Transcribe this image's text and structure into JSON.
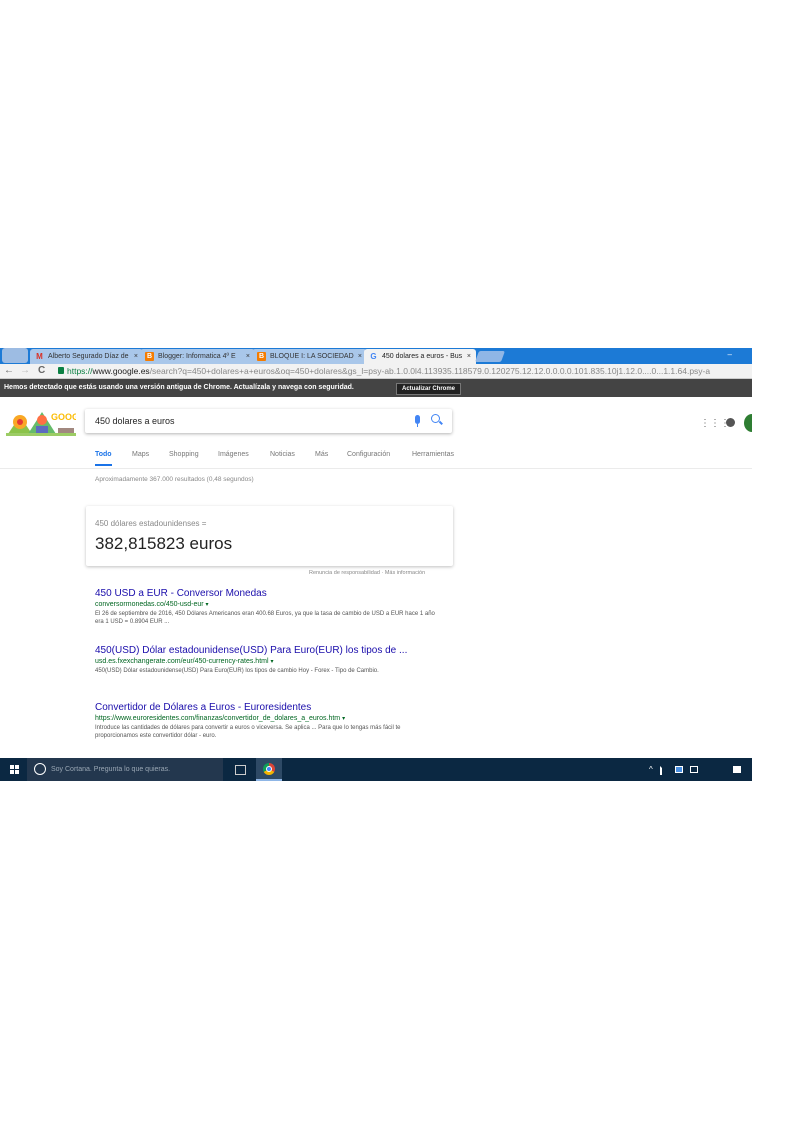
{
  "browser": {
    "tabs": [
      {
        "label": "Alberto Segurado Díaz de",
        "favicon": "gmail-icon",
        "close": "×",
        "active": false
      },
      {
        "label": "Blogger: Informatica 4º E",
        "favicon": "blogger-icon",
        "close": "×",
        "active": false
      },
      {
        "label": "BLOQUE I: LA SOCIEDAD",
        "favicon": "blogger-icon",
        "close": "×",
        "active": false
      },
      {
        "label": "450 dolares a euros - Bus",
        "favicon": "google-icon",
        "close": "×",
        "active": true
      }
    ],
    "minimize": "–",
    "nav": {
      "back": "←",
      "forward": "→",
      "reload": "C"
    },
    "url_scheme": "https://",
    "url_host": "www.google.es",
    "url_rest": "/search?q=450+dolares+a+euros&oq=450+dolares&gs_l=psy-ab.1.0.0l4.113935.118579.0.120275.12.12.0.0.0.0.101.835.10j1.12.0....0...1.1.64.psy-a",
    "infobar_message": "Hemos detectado que estás usando una versión antigua de Chrome. Actualízala y navega con seguridad.",
    "infobar_button": "Actualizar Chrome"
  },
  "google": {
    "logo_text": "GOOGLE",
    "query": "450 dolares a euros",
    "tabs": [
      "Todo",
      "Maps",
      "Shopping",
      "Imágenes",
      "Noticias",
      "Más",
      "Configuración",
      "Herramientas"
    ],
    "stats": "Aproximadamente 367.000 resultados (0,48 segundos)",
    "converter": {
      "from": "450 dólares estadounidenses =",
      "to": "382,815823 euros",
      "disclaimer": "Renuncia de responsabilidad · Más información"
    },
    "results": [
      {
        "title": "450 USD a EUR - Conversor Monedas",
        "url": "conversormonedas.co/450-usd-eur",
        "snippet": "El 26 de septiembre de 2016, 450 Dólares Americanos eran 400.68 Euros, ya que la tasa de cambio de USD a EUR hace 1 año era 1 USD = 0.8904 EUR ..."
      },
      {
        "title": "450(USD) Dólar estadounidense(USD) Para Euro(EUR) los tipos de ...",
        "url": "usd.es.fxexchangerate.com/eur/450-currency-rates.html",
        "snippet": "450(USD) Dólar estadounidense(USD) Para Euro(EUR) los tipos de cambio Hoy - Forex - Tipo de Cambio."
      },
      {
        "title": "Convertidor de Dólares a Euros - Euroresidentes",
        "url": "https://www.euroresidentes.com/finanzas/convertidor_de_dolares_a_euros.htm",
        "snippet": "Introduce las cantidades de dólares para convertir a euros o viceversa. Se aplica ... Para que lo tengas más fácil te proporcionamos este convertidor dólar - euro."
      }
    ]
  },
  "taskbar": {
    "cortana_placeholder": "Soy Cortana. Pregunta lo que quieras.",
    "tray_chevron": "^"
  },
  "colors": {
    "tabbar": "#1c7ad6",
    "link": "#1a0dab",
    "url_green": "#006621",
    "taskbar": "#0b2842"
  }
}
